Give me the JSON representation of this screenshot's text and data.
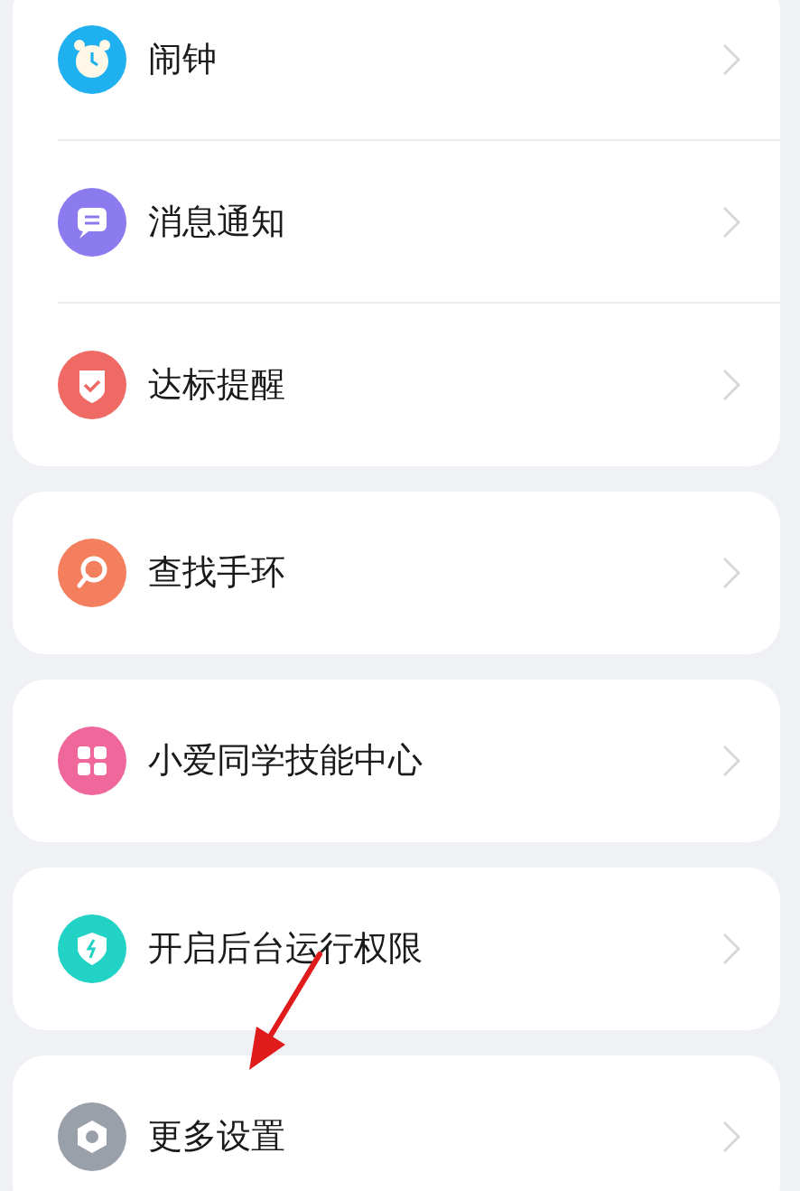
{
  "groups": [
    {
      "items": [
        {
          "label": "闹钟",
          "kind": "alarm",
          "color": "#1fb0f0"
        },
        {
          "label": "消息通知",
          "kind": "message",
          "color": "#8b7bee"
        },
        {
          "label": "达标提醒",
          "kind": "badge",
          "color": "#f06a65"
        }
      ]
    },
    {
      "items": [
        {
          "label": "查找手环",
          "kind": "search",
          "color": "#f47f5f"
        }
      ]
    },
    {
      "items": [
        {
          "label": "小爱同学技能中心",
          "kind": "grid",
          "color": "#f0679b"
        }
      ]
    },
    {
      "items": [
        {
          "label": "开启后台运行权限",
          "kind": "shield",
          "color": "#22d3c5"
        }
      ]
    },
    {
      "items": [
        {
          "label": "更多设置",
          "kind": "gear",
          "color": "#9aa0aa"
        }
      ]
    }
  ]
}
